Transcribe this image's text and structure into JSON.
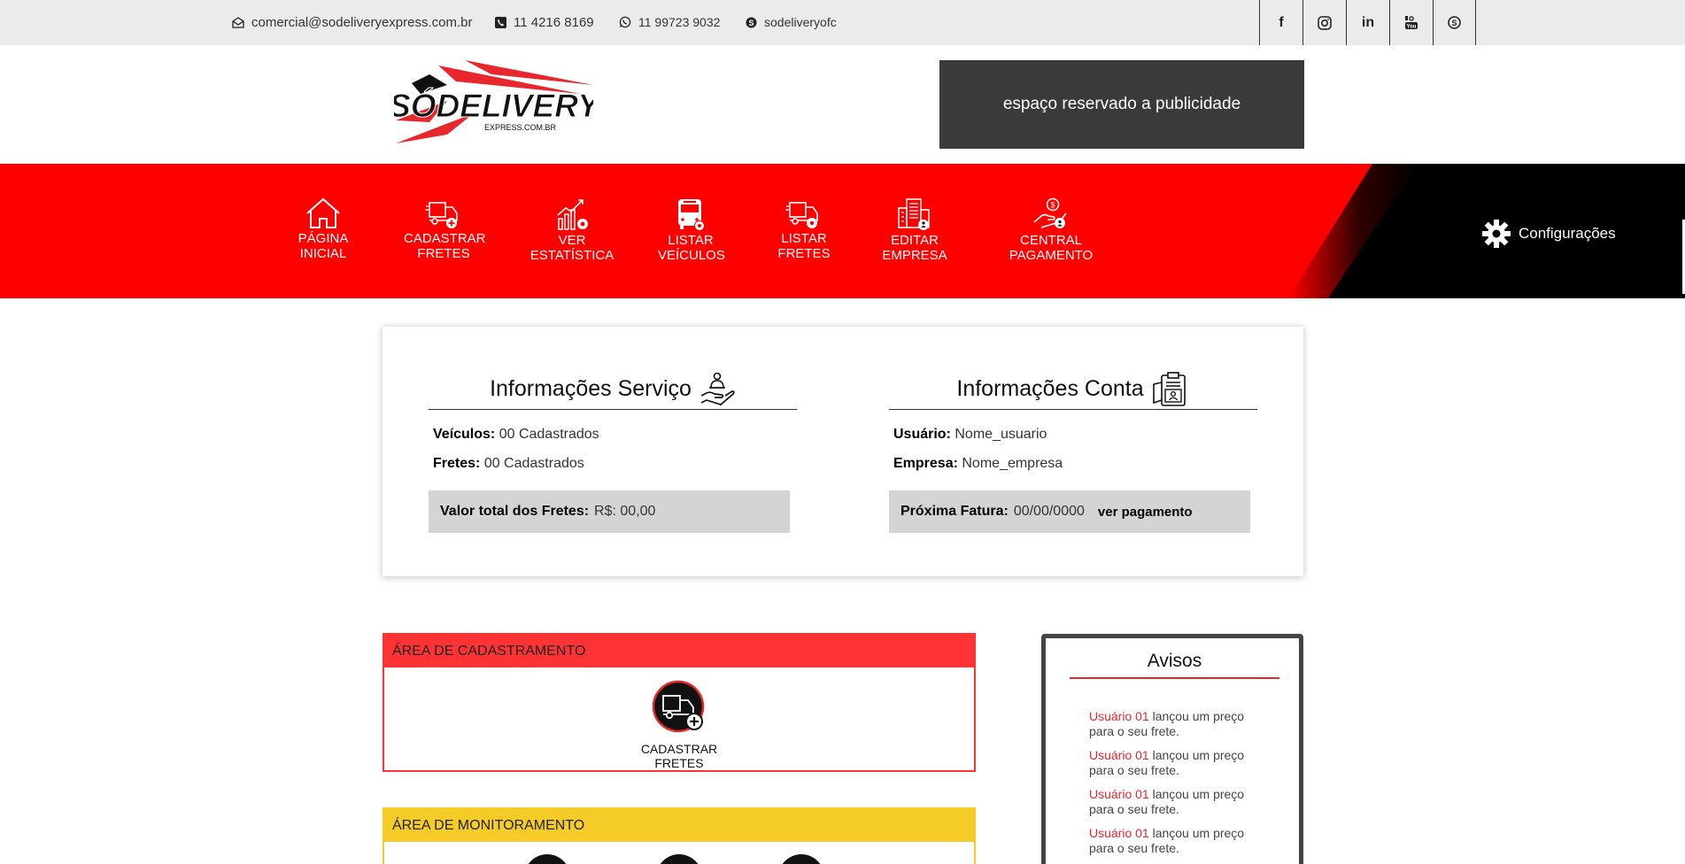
{
  "topbar": {
    "email": "comercial@sodeliveryexpress.com.br",
    "phone": "11 4216 8169",
    "whatsapp": "11 99723 9032",
    "skype": "sodeliveryofc",
    "social": [
      "f",
      "instagram-icon",
      "in",
      "youtube-icon",
      "skype-icon"
    ]
  },
  "header": {
    "logo_text": "SÓDELIVERY",
    "logo_sub": "EXPRESS.COM.BR",
    "ad_text": "espaço reservado a publicidade"
  },
  "nav": {
    "items": [
      {
        "line1": "Página",
        "line2": "Inicial",
        "icon": "home-icon"
      },
      {
        "line1": "Cadastrar",
        "line2": "Fretes",
        "icon": "truck-add-icon"
      },
      {
        "line1": "Ver",
        "line2": "Estatística",
        "icon": "chart-icon"
      },
      {
        "line1": "Listar",
        "line2": "Veículos",
        "icon": "bus-icon"
      },
      {
        "line1": "Listar",
        "line2": "Fretes",
        "icon": "truck-list-icon"
      },
      {
        "line1": "Editar",
        "line2": "Empresa",
        "icon": "building-icon"
      },
      {
        "line1": "Central",
        "line2": "Pagamento",
        "icon": "payment-icon"
      }
    ],
    "config_label": "Configurações",
    "colors": {
      "primary": "#ff0000",
      "secondary": "#000000"
    }
  },
  "info": {
    "service": {
      "title": "Informações Serviço",
      "vehicles_label": "Veículos:",
      "vehicles_value": "00 Cadastrados",
      "freights_label": "Fretes:",
      "freights_value": "00 Cadastrados",
      "total_label": "Valor total dos Fretes:",
      "total_value": "R$: 00,00"
    },
    "account": {
      "title": "Informações Conta",
      "user_label": "Usuário:",
      "user_value": "Nome_usuario",
      "company_label": "Empresa:",
      "company_value": "Nome_empresa",
      "invoice_label": "Próxima Fatura:",
      "invoice_value": "00/00/0000",
      "invoice_link": "ver pagamento"
    }
  },
  "cadastro": {
    "title": "ÁREA DE CADASTRAMENTO",
    "button": "CADASTRAR FRETES",
    "color": "#ff3333"
  },
  "monitoramento": {
    "title": "ÁREA DE MONITORAMENTO",
    "color": "#f5cc27"
  },
  "avisos": {
    "title": "Avisos",
    "items": [
      {
        "user": "Usuário 01",
        "text": " lançou um preço para o seu frete."
      },
      {
        "user": "Usuário 01",
        "text": " lançou um preço para o seu frete."
      },
      {
        "user": "Usuário 01",
        "text": " lançou um preço para o seu frete."
      },
      {
        "user": "Usuário 01",
        "text": " lançou um preço para o seu frete."
      }
    ]
  }
}
